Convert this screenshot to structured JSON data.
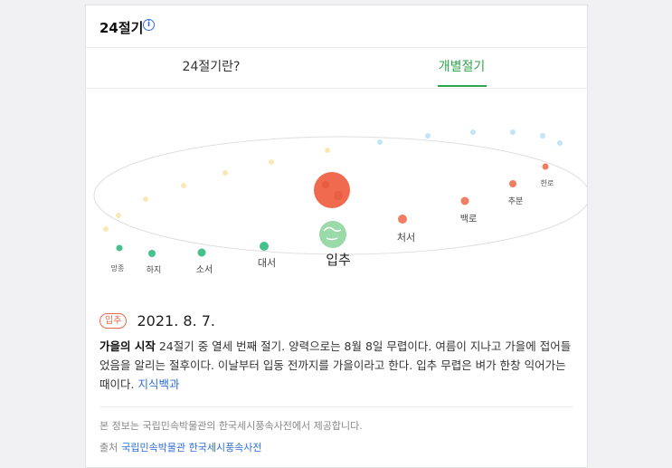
{
  "header": {
    "title": "24절기",
    "info_icon": "info-icon"
  },
  "tabs": [
    {
      "label": "24절기란?",
      "active": false
    },
    {
      "label": "개별절기",
      "active": true
    }
  ],
  "orbit": {
    "front_terms": [
      {
        "label": "하지"
      },
      {
        "label": "소서"
      },
      {
        "label": "대서"
      },
      {
        "label": "입추"
      },
      {
        "label": "처서"
      },
      {
        "label": "백로"
      },
      {
        "label": "추분"
      },
      {
        "label": "한로"
      }
    ],
    "colors": {
      "summer": "#45c18e",
      "autumn": "#ef7e62",
      "winter": "#8dd0ef",
      "spring": "#f5d67a",
      "sun": "#ef6a4e",
      "earth": "#9ad9a8"
    }
  },
  "detail": {
    "badge": "입추",
    "date": "2021. 8. 7.",
    "heading": "가을의 시작",
    "text": " 24절기 중 열세 번째 절기. 양력으로는 8월 8일 무렵이다. 여름이 지나고 가을에 접어들었음을 알리는 절후이다. 이날부터 입동 전까지를 가을이라고 한다. 입추 무렵은 벼가 한창 익어가는 때이다. ",
    "link": "지식백과"
  },
  "footer": {
    "note": "본 정보는 국립민속박물관의 한국세시풍속사전에서 제공합니다.",
    "source_label": "출처",
    "source_link": "국립민속박물관 한국세시풍속사전"
  }
}
